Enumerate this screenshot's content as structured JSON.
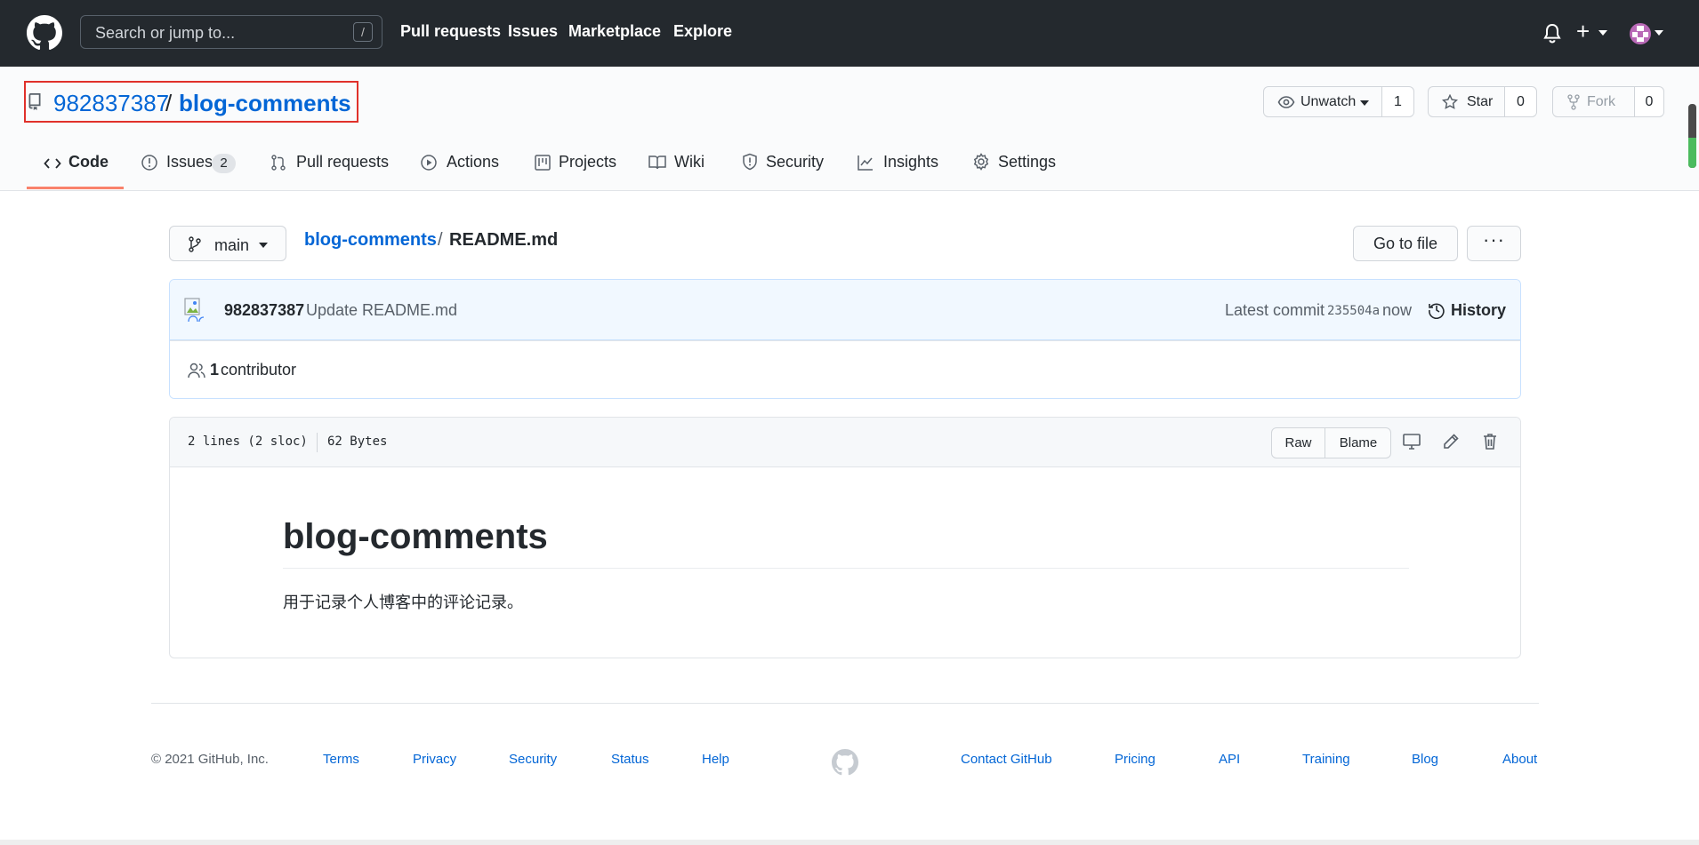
{
  "nav": {
    "search_placeholder": "Search or jump to...",
    "slash_hint": "/",
    "links": [
      "Pull requests",
      "Issues",
      "Marketplace",
      "Explore"
    ],
    "plus": "+"
  },
  "repo": {
    "owner": "982837387",
    "separator": "/",
    "name": "blog-comments",
    "unwatch_label": "Unwatch",
    "watch_count": "1",
    "star_label": "Star",
    "star_count": "0",
    "fork_label": "Fork",
    "fork_count": "0"
  },
  "tabs": [
    {
      "label": "Code",
      "active": true
    },
    {
      "label": "Issues",
      "count": "2"
    },
    {
      "label": "Pull requests"
    },
    {
      "label": "Actions"
    },
    {
      "label": "Projects"
    },
    {
      "label": "Wiki"
    },
    {
      "label": "Security"
    },
    {
      "label": "Insights"
    },
    {
      "label": "Settings"
    }
  ],
  "file_nav": {
    "branch": "main",
    "crumb_repo": "blog-comments",
    "crumb_sep": "/",
    "crumb_file": "README.md",
    "goto_file": "Go to file",
    "more": "···"
  },
  "commit": {
    "author": "982837387",
    "message": "Update README.md",
    "latest_label": "Latest commit",
    "sha": "235504a",
    "time": "now",
    "history_label": "History",
    "contributor_count": "1",
    "contributor_label": "contributor"
  },
  "file": {
    "lines": "2 lines (2 sloc)",
    "size": "62 Bytes",
    "raw_label": "Raw",
    "blame_label": "Blame",
    "md_title": "blog-comments",
    "md_paragraph": "用于记录个人博客中的评论记录。"
  },
  "footer": {
    "copyright": "© 2021 GitHub, Inc.",
    "left_links": [
      "Terms",
      "Privacy",
      "Security",
      "Status",
      "Help"
    ],
    "right_links": [
      "Contact GitHub",
      "Pricing",
      "API",
      "Training",
      "Blog",
      "About"
    ]
  },
  "colors": {
    "nav_bg": "#24292e",
    "link": "#0366d6",
    "active_tab": "#f9826c",
    "highlight_box": "#e0312b"
  }
}
